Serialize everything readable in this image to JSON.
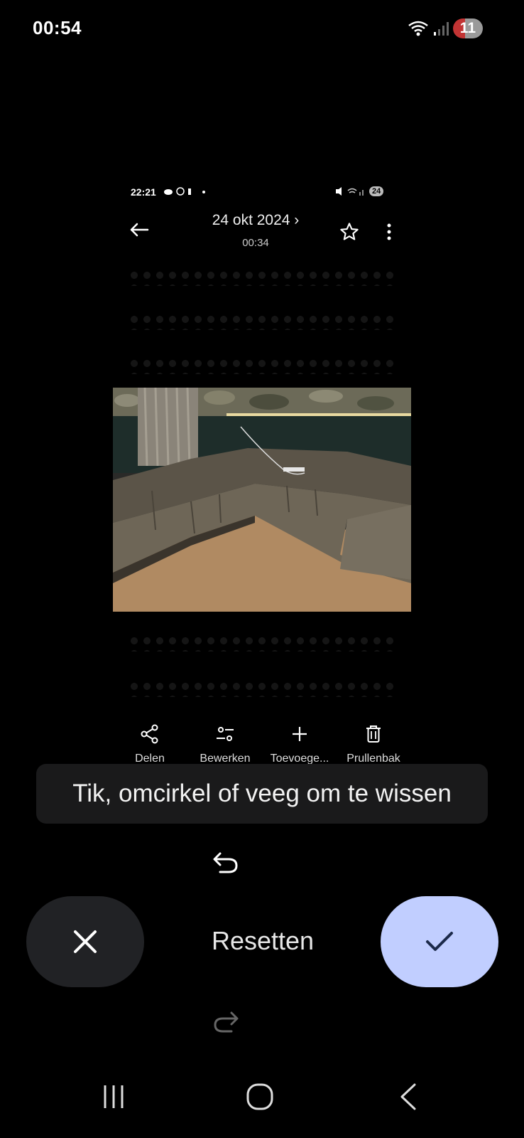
{
  "status_bar": {
    "time": "00:54",
    "notification_count": "11",
    "icons": [
      "wifi-icon",
      "signal-icon"
    ]
  },
  "inner_screenshot": {
    "status_time": "22:21",
    "status_badge": "24",
    "header": {
      "title": "24 okt 2024 ›",
      "subtitle": "00:34"
    },
    "actions": [
      {
        "label": "Delen",
        "icon": "share-icon"
      },
      {
        "label": "Bewerken",
        "icon": "tune-icon"
      },
      {
        "label": "Toevoege...",
        "icon": "add-icon"
      },
      {
        "label": "Prullenbak",
        "icon": "trash-icon"
      }
    ]
  },
  "toast": {
    "text": "Tik, omcirkel of veeg om te wissen"
  },
  "controls": {
    "reset_label": "Resetten",
    "accent_color": "#c1ceff"
  }
}
